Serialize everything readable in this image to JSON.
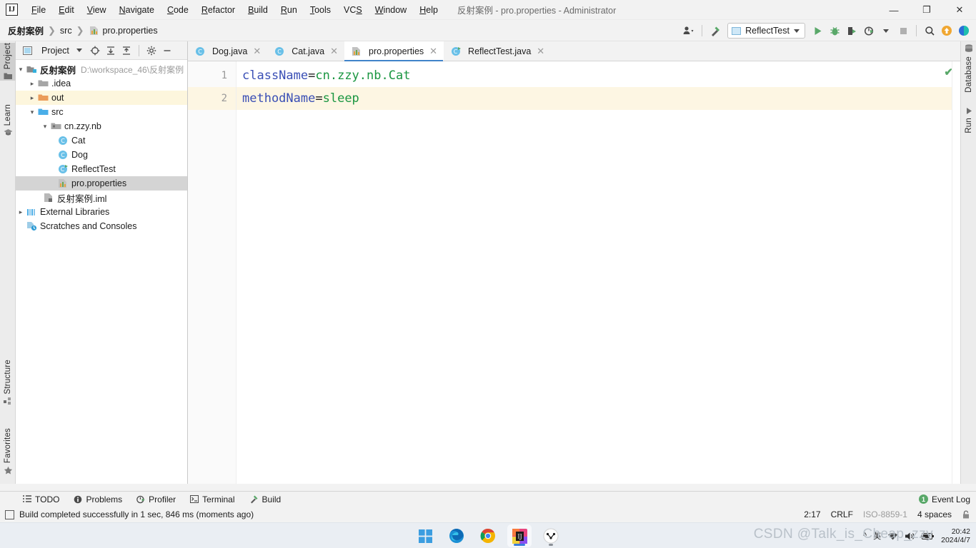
{
  "window": {
    "title_project": "反射案例",
    "title_rest": " - pro.properties - Administrator",
    "minimize": "—",
    "maximize": "❐",
    "close": "✕"
  },
  "menu": {
    "items": [
      {
        "label": "File",
        "icon": "file-menu"
      },
      {
        "label": "Edit",
        "icon": "edit-menu"
      },
      {
        "label": "View",
        "icon": "view-menu"
      },
      {
        "label": "Navigate",
        "icon": "navigate-menu"
      },
      {
        "label": "Code",
        "icon": "code-menu"
      },
      {
        "label": "Refactor",
        "icon": "refactor-menu"
      },
      {
        "label": "Build",
        "icon": "build-menu"
      },
      {
        "label": "Run",
        "icon": "run-menu"
      },
      {
        "label": "Tools",
        "icon": "tools-menu"
      },
      {
        "label": "VCS",
        "icon": "vcs-menu"
      },
      {
        "label": "Window",
        "icon": "window-menu"
      },
      {
        "label": "Help",
        "icon": "help-menu"
      }
    ]
  },
  "breadcrumbs": {
    "items": [
      {
        "label": "反射案例",
        "icon": "project-icon"
      },
      {
        "label": "src",
        "icon": "folder-icon"
      },
      {
        "label": "pro.properties",
        "icon": "properties-file-icon"
      }
    ],
    "separator": "❯"
  },
  "toolbar": {
    "run_config": "ReflectTest",
    "buttons": [
      {
        "name": "user-icon",
        "title": "Account"
      },
      {
        "name": "hammer-icon",
        "title": "Build Project"
      },
      {
        "name": "run-icon",
        "title": "Run"
      },
      {
        "name": "debug-icon",
        "title": "Debug"
      },
      {
        "name": "coverage-icon",
        "title": "Run with Coverage"
      },
      {
        "name": "profiler-icon",
        "title": "Profiler"
      },
      {
        "name": "stop-icon",
        "title": "Stop"
      },
      {
        "name": "search-icon",
        "title": "Search Everywhere"
      },
      {
        "name": "update-icon",
        "title": "Update"
      },
      {
        "name": "ide-icon",
        "title": "IDE"
      }
    ]
  },
  "left_strip": {
    "top": [
      {
        "label": "Project",
        "icon": "project-tool-icon",
        "selected": true
      }
    ],
    "mid": [
      {
        "label": "Learn",
        "icon": "learn-icon",
        "selected": false
      }
    ],
    "bottom": [
      {
        "label": "Structure",
        "icon": "structure-icon",
        "selected": false
      },
      {
        "label": "Favorites",
        "icon": "star-icon",
        "selected": false
      }
    ]
  },
  "right_strip": {
    "items": [
      {
        "label": "Database",
        "icon": "database-icon"
      },
      {
        "label": "Run",
        "icon": "run-triangle-icon"
      }
    ]
  },
  "project_panel": {
    "header_title": "Project",
    "header_buttons": [
      {
        "name": "chevron-down-icon"
      },
      {
        "name": "locate-target-icon"
      },
      {
        "name": "expand-all-icon"
      },
      {
        "name": "collapse-all-icon"
      },
      {
        "name": "gear-icon"
      },
      {
        "name": "hide-icon"
      }
    ],
    "tree": [
      {
        "label": "反射案例",
        "path": "D:\\workspace_46\\反射案例",
        "indent": 0,
        "arrow": "v",
        "icon": "module-icon",
        "bold": true,
        "state": "normal"
      },
      {
        "label": ".idea",
        "path": "",
        "indent": 1,
        "arrow": ">",
        "icon": "folder-gray-icon",
        "bold": false,
        "state": "normal"
      },
      {
        "label": "out",
        "path": "",
        "indent": 1,
        "arrow": ">",
        "icon": "folder-orange-icon",
        "bold": false,
        "state": "highlight"
      },
      {
        "label": "src",
        "path": "",
        "indent": 1,
        "arrow": "v",
        "icon": "folder-blue-icon",
        "bold": false,
        "state": "normal"
      },
      {
        "label": "cn.zzy.nb",
        "path": "",
        "indent": 2,
        "arrow": "v",
        "icon": "package-icon",
        "bold": false,
        "state": "normal"
      },
      {
        "label": "Cat",
        "path": "",
        "indent": 3,
        "arrow": "",
        "icon": "class-icon",
        "bold": false,
        "state": "normal"
      },
      {
        "label": "Dog",
        "path": "",
        "indent": 3,
        "arrow": "",
        "icon": "class-icon",
        "bold": false,
        "state": "normal"
      },
      {
        "label": "ReflectTest",
        "path": "",
        "indent": 3,
        "arrow": "",
        "icon": "runnable-class-icon",
        "bold": false,
        "state": "normal"
      },
      {
        "label": "pro.properties",
        "path": "",
        "indent": 2,
        "arrow": "",
        "icon": "properties-file-icon",
        "bold": false,
        "state": "selected"
      },
      {
        "label": "反射案例.iml",
        "path": "",
        "indent": 1,
        "arrow": "",
        "icon": "iml-file-icon",
        "bold": false,
        "state": "normal"
      },
      {
        "label": "External Libraries",
        "path": "",
        "indent": 0,
        "arrow": ">",
        "icon": "libraries-icon",
        "bold": false,
        "state": "normal"
      },
      {
        "label": "Scratches and Consoles",
        "path": "",
        "indent": 0,
        "arrow": "",
        "icon": "scratches-icon",
        "bold": false,
        "state": "normal"
      }
    ]
  },
  "editor": {
    "tabs": [
      {
        "label": "Dog.java",
        "icon": "class-icon",
        "active": false,
        "close": "✕"
      },
      {
        "label": "Cat.java",
        "icon": "class-icon",
        "active": false,
        "close": "✕"
      },
      {
        "label": "pro.properties",
        "icon": "properties-file-icon",
        "active": true,
        "close": "✕"
      },
      {
        "label": "ReflectTest.java",
        "icon": "runnable-class-icon",
        "active": false,
        "close": "✕"
      }
    ],
    "lines": [
      {
        "number": "1",
        "key": "className",
        "eq": "=",
        "value": "cn.zzy.nb.Cat",
        "current": false
      },
      {
        "number": "2",
        "key": "methodName",
        "eq": "=",
        "value": "sleep",
        "current": true
      }
    ],
    "inspection_icon": "✔"
  },
  "bottom_bar": {
    "items": [
      {
        "label": "TODO",
        "icon": "todo-icon"
      },
      {
        "label": "Problems",
        "icon": "problems-icon"
      },
      {
        "label": "Profiler",
        "icon": "profiler-icon"
      },
      {
        "label": "Terminal",
        "icon": "terminal-icon"
      },
      {
        "label": "Build",
        "icon": "build-hammer-icon"
      }
    ],
    "event_log": "Event Log",
    "event_log_count": "1"
  },
  "status_bar": {
    "message": "Build completed successfully in 1 sec, 846 ms (moments ago)",
    "message_icon": "build-status-icon",
    "caret_position": "2:17",
    "line_separator": "CRLF",
    "encoding": "ISO-8859-1",
    "indent": "4 spaces",
    "lock_icon": "lock-icon"
  },
  "taskbar": {
    "apps": [
      {
        "name": "start-icon",
        "label": "Start",
        "active": false,
        "running": false
      },
      {
        "name": "edge-icon",
        "label": "Microsoft Edge",
        "active": false,
        "running": true
      },
      {
        "name": "chrome-icon",
        "label": "Google Chrome",
        "active": false,
        "running": true
      },
      {
        "name": "intellij-icon",
        "label": "IntelliJ IDEA",
        "active": true,
        "running": true
      },
      {
        "name": "app-icon",
        "label": "App",
        "active": false,
        "running": true
      }
    ],
    "tray": [
      {
        "name": "chevron-up-icon",
        "label": "^"
      },
      {
        "name": "ime-icon",
        "label": "英"
      },
      {
        "name": "wifi-icon",
        "label": "wifi"
      },
      {
        "name": "volume-icon",
        "label": "volume"
      },
      {
        "name": "battery-icon",
        "label": "battery"
      }
    ],
    "clock_time": "20:42",
    "clock_date": "2024/4/7"
  },
  "watermark": "CSDN @Talk_is_Cheap_zzy",
  "colors": {
    "accent_blue": "#4083c9",
    "green": "#59a869",
    "key_blue": "#3a4fb5",
    "value_green": "#1a9641",
    "highlight_row": "#fdf6dd",
    "selected_row": "#d4d4d4"
  }
}
